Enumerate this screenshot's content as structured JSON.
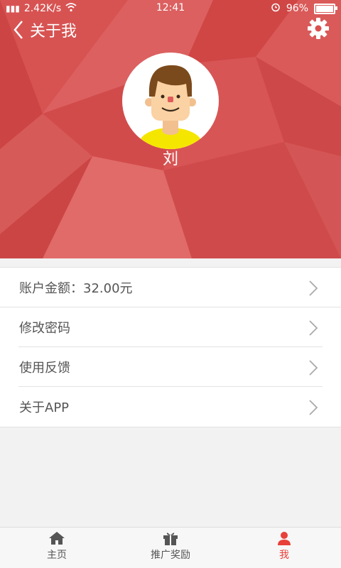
{
  "status_bar": {
    "network_speed": "2.42K/s",
    "time": "12:41",
    "battery_percent": "96%",
    "battery_level": 0.96
  },
  "topbar": {
    "title": "关于我",
    "back_icon": "chevron-left-icon",
    "settings_icon": "gear-icon"
  },
  "profile": {
    "name": "刘"
  },
  "menu": {
    "items": [
      {
        "label": "账户金额：32.00元"
      },
      {
        "label": "修改密码"
      },
      {
        "label": "使用反馈"
      },
      {
        "label": "关于APP"
      }
    ]
  },
  "tabbar": {
    "tabs": [
      {
        "label": "主页",
        "icon": "home-icon"
      },
      {
        "label": "推广奖励",
        "icon": "gift-icon"
      },
      {
        "label": "我",
        "icon": "user-icon"
      }
    ],
    "active_index": 2
  },
  "colors": {
    "accent": "#e8403a",
    "header": "#d9504f"
  }
}
